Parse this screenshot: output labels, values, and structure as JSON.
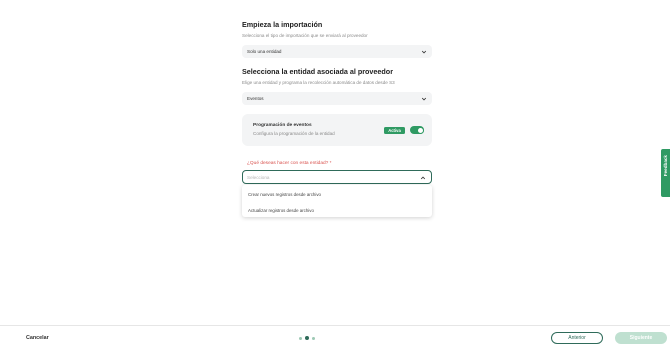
{
  "import": {
    "title": "Empieza la importación",
    "subtitle": "Selecciona el tipo de importación que se enviará al proveedor",
    "select_value": "Solo una entidad"
  },
  "entity": {
    "title": "Selecciona la entidad asociada al proveedor",
    "subtitle": "Elige una entidad y programa la recolección automática de datos desde S3",
    "select_value": "Eventos"
  },
  "schedule_card": {
    "title": "Programación de eventos",
    "subtitle": "Configura la programación de la entidad",
    "badge": "Activa",
    "toggle_on": true
  },
  "action": {
    "question": "¿Qué deseas hacer con esta entidad? *",
    "placeholder": "Selecciona",
    "options": [
      "Crear nuevos registros desde archivo",
      "Actualizar registros desde archivo"
    ]
  },
  "feedback_tab": {
    "label": "Feedback"
  },
  "footer": {
    "cancel": "Cancelar",
    "steps_total": 3,
    "current_step": 2,
    "prev": "Anterior",
    "next": "Siguiente"
  },
  "colors": {
    "accent": "#2f9a63",
    "accent_dark": "#2f6b5a",
    "required": "#d9534f",
    "disabled_button": "#bfe0d0"
  }
}
